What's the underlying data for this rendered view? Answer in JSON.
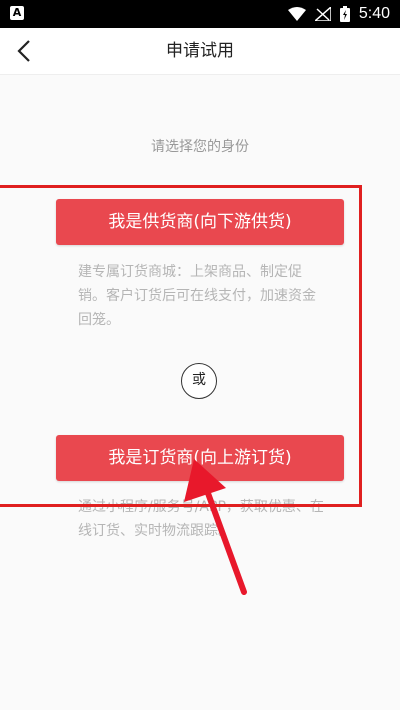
{
  "status_bar": {
    "app_icon_letter": "A",
    "time": "5:40"
  },
  "header": {
    "title": "申请试用"
  },
  "main": {
    "prompt": "请选择您的身份",
    "supplier": {
      "button_label": "我是供货商(向下游供货)",
      "description": "建专属订货商城：上架商品、制定促销。客户订货后可在线支付，加速资金回笼。"
    },
    "or_label": "或",
    "buyer": {
      "button_label": "我是订货商(向上游订货)",
      "description": "通过小程序/服务号/APP，获取优惠、在线订货、实时物流跟踪。"
    }
  },
  "colors": {
    "accent": "#e9484f",
    "highlight_box": "#e02020",
    "annotation_arrow": "#e8182b"
  }
}
